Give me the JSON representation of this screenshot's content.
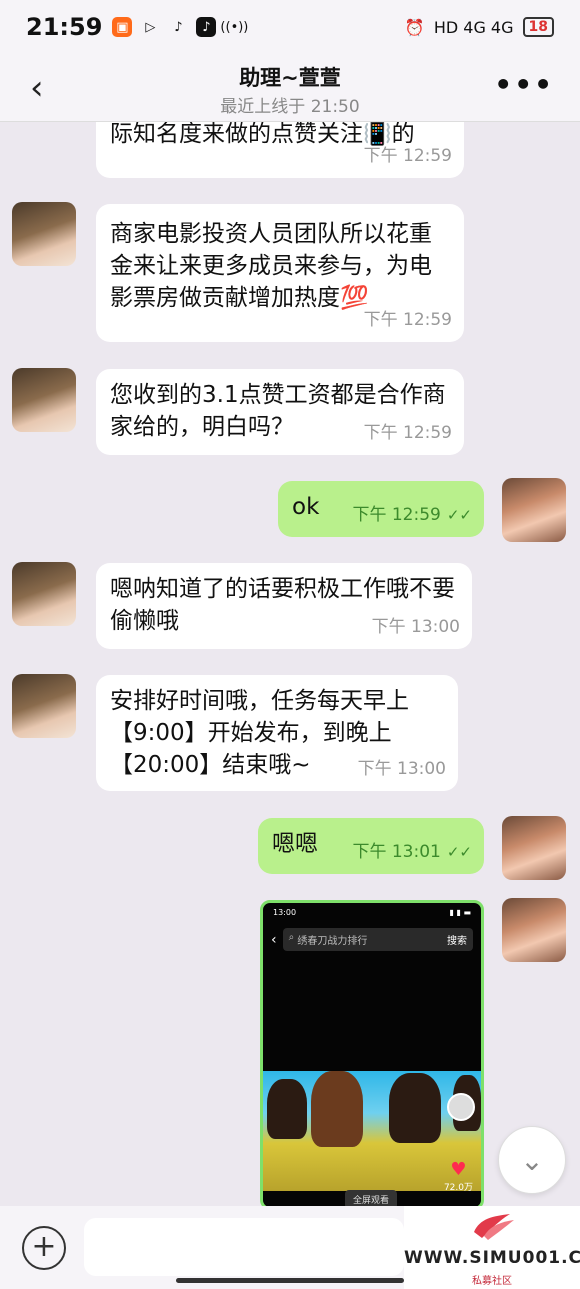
{
  "status_bar": {
    "time": "21:59",
    "network": "HD 4G 4G",
    "battery": "18"
  },
  "header": {
    "title": "助理~萱萱",
    "subtitle": "最近上线于 21:50"
  },
  "messages": [
    {
      "dir": "in",
      "avatar": false,
      "text": "际知名度来做的点赞关注📳的",
      "time": "下午 12:59"
    },
    {
      "dir": "in",
      "avatar": true,
      "text": "商家电影投资人员团队所以花重金来让来更多成员来参与，为电影票房做贡献增加热度💯",
      "time": "下午 12:59"
    },
    {
      "dir": "in",
      "avatar": true,
      "text": "您收到的3.1点赞工资都是合作商家给的，明白吗？",
      "time": "下午 12:59"
    },
    {
      "dir": "out",
      "avatar": true,
      "text": "ok",
      "time": "下午 12:59",
      "read": "✓✓"
    },
    {
      "dir": "in",
      "avatar": true,
      "text": "嗯呐知道了的话要积极工作哦不要偷懒哦",
      "time": "下午 13:00"
    },
    {
      "dir": "in",
      "avatar": true,
      "text": "安排好时间哦，任务每天早上【9:00】开始发布，到晚上【20:00】结束哦~",
      "time": "下午 13:00"
    },
    {
      "dir": "out",
      "avatar": true,
      "text": "嗯嗯",
      "time": "下午 13:01",
      "read": "✓✓"
    }
  ],
  "video_card": {
    "phone_time": "13:00",
    "search_text": "绣春刀战力排行",
    "search_button": "搜索",
    "likes": "72.0万",
    "fullscreen": "全屏观看"
  },
  "input": {
    "placeholder": ""
  },
  "watermark": {
    "url": "WWW.SIMU001.CN",
    "name": "私募社区"
  },
  "icons": [
    "back-icon",
    "more-icon",
    "plus-icon",
    "chevron-down-icon",
    "heart-icon"
  ]
}
